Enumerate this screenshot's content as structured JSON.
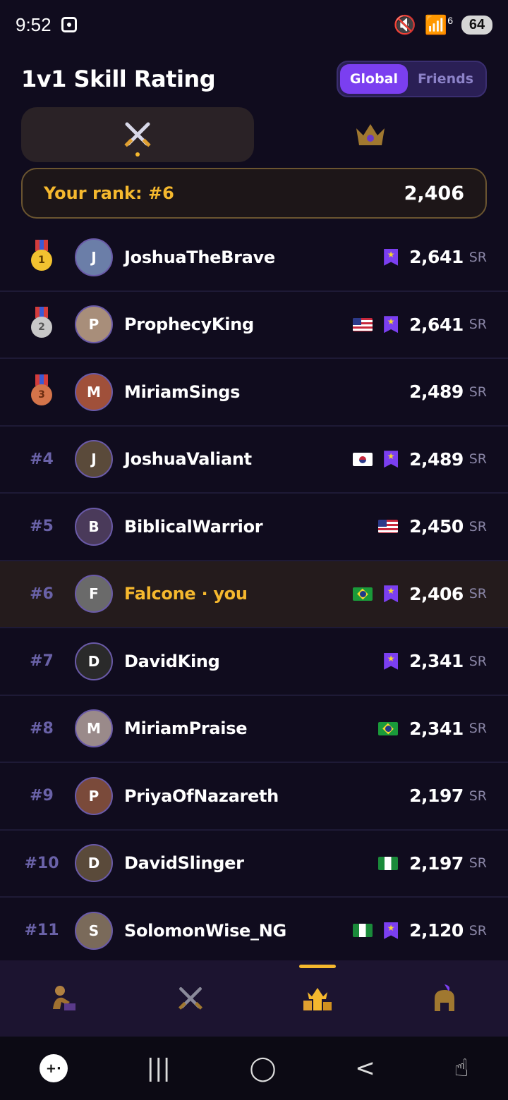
{
  "status_bar": {
    "time": "9:52",
    "network": "6",
    "battery": "64"
  },
  "header": {
    "title": "1v1 Skill Rating",
    "scope_tabs": [
      "Global",
      "Friends"
    ],
    "active_scope": "Global"
  },
  "mode_tabs": [
    {
      "icon": "crossed-swords-icon",
      "active": true
    },
    {
      "icon": "crown-icon",
      "active": false
    }
  ],
  "my_rank": {
    "label": "Your rank: #6",
    "score": "2,406"
  },
  "unit": "SR",
  "leaderboard": [
    {
      "rank": "",
      "medal": "gold",
      "medal_num": "1",
      "name": "JoshuaTheBrave",
      "flag": "",
      "badge": true,
      "score": "2,641",
      "avatar_color": "#6b7ea8",
      "avatar_text": "J"
    },
    {
      "rank": "",
      "medal": "silver",
      "medal_num": "2",
      "name": "ProphecyKing",
      "flag": "us",
      "badge": true,
      "score": "2,641",
      "avatar_color": "#a88e7a",
      "avatar_text": "P"
    },
    {
      "rank": "",
      "medal": "bronze",
      "medal_num": "3",
      "name": "MiriamSings",
      "flag": "",
      "badge": false,
      "score": "2,489",
      "avatar_color": "#a0503a",
      "avatar_text": "M"
    },
    {
      "rank": "#4",
      "medal": "",
      "medal_num": "",
      "name": "JoshuaValiant",
      "flag": "kr",
      "badge": true,
      "score": "2,489",
      "avatar_color": "#5a4a3a",
      "avatar_text": "J"
    },
    {
      "rank": "#5",
      "medal": "",
      "medal_num": "",
      "name": "BiblicalWarrior",
      "flag": "us",
      "badge": false,
      "score": "2,450",
      "avatar_color": "#4a3a5a",
      "avatar_text": "B"
    },
    {
      "rank": "#6",
      "medal": "",
      "medal_num": "",
      "name": "Falcone · you",
      "flag": "br",
      "badge": true,
      "score": "2,406",
      "avatar_color": "#6a6a6a",
      "avatar_text": "F",
      "me": true
    },
    {
      "rank": "#7",
      "medal": "",
      "medal_num": "",
      "name": "DavidKing",
      "flag": "",
      "badge": true,
      "score": "2,341",
      "avatar_color": "#2a2a2a",
      "avatar_text": "D"
    },
    {
      "rank": "#8",
      "medal": "",
      "medal_num": "",
      "name": "MiriamPraise",
      "flag": "br",
      "badge": false,
      "score": "2,341",
      "avatar_color": "#9a8a8a",
      "avatar_text": "M"
    },
    {
      "rank": "#9",
      "medal": "",
      "medal_num": "",
      "name": "PriyaOfNazareth",
      "flag": "",
      "badge": false,
      "score": "2,197",
      "avatar_color": "#7a4a3a",
      "avatar_text": "P"
    },
    {
      "rank": "#10",
      "medal": "",
      "medal_num": "",
      "name": "DavidSlinger",
      "flag": "ng",
      "badge": false,
      "score": "2,197",
      "avatar_color": "#5a4a3a",
      "avatar_text": "D"
    },
    {
      "rank": "#11",
      "medal": "",
      "medal_num": "",
      "name": "SolomonWise_NG",
      "flag": "ng",
      "badge": true,
      "score": "2,120",
      "avatar_color": "#7a6a5a",
      "avatar_text": "S"
    }
  ],
  "bottom_nav": [
    {
      "icon": "reader-icon",
      "active": false
    },
    {
      "icon": "crossed-swords-icon",
      "active": false
    },
    {
      "icon": "crown-trophy-icon",
      "active": true
    },
    {
      "icon": "helmet-icon",
      "active": false
    }
  ],
  "colors": {
    "accent": "#7b3ff0",
    "gold": "#f5b82e",
    "background": "#100c1e"
  }
}
